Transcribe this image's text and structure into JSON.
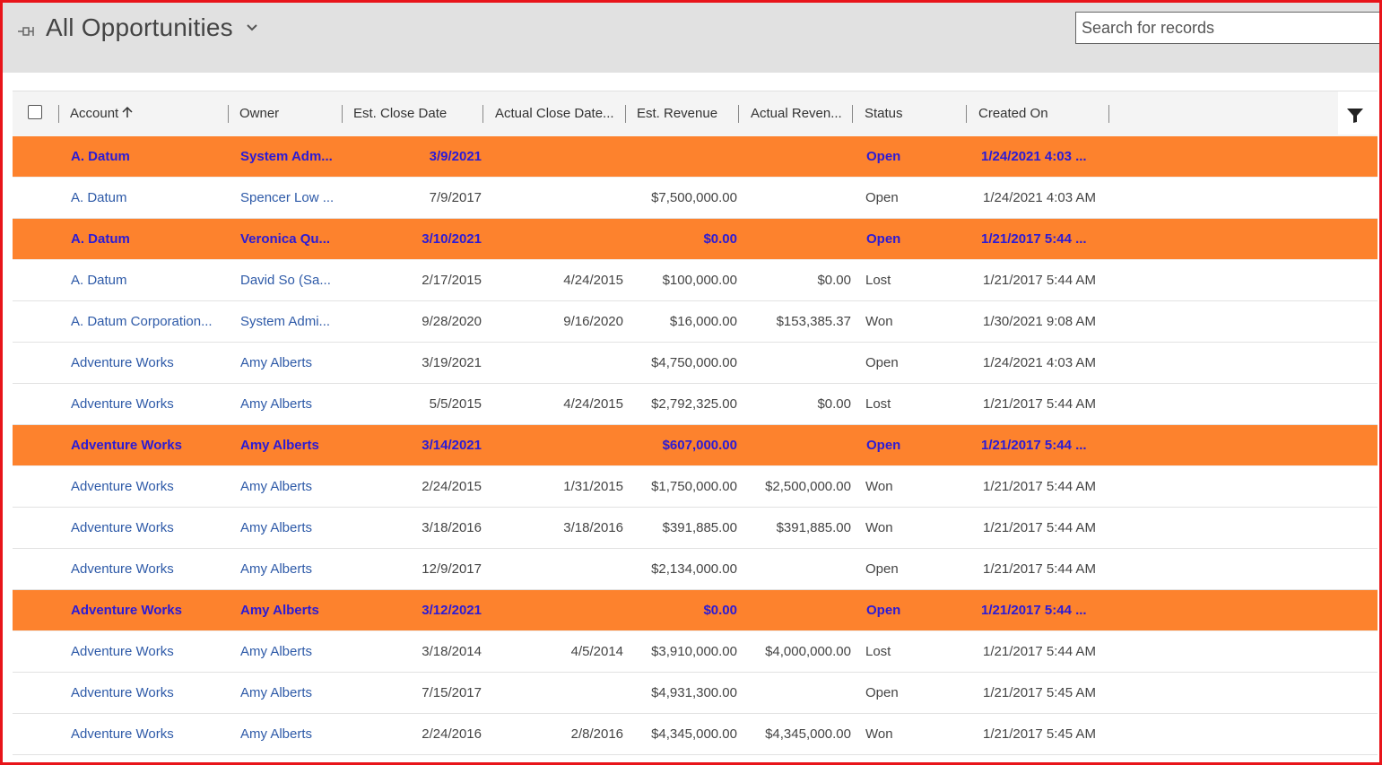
{
  "view": {
    "title": "All Opportunities"
  },
  "search": {
    "placeholder": "Search for records"
  },
  "columns": {
    "account": "Account",
    "owner": "Owner",
    "est_close_date": "Est. Close Date",
    "actual_close_date": "Actual Close Date...",
    "est_revenue": "Est. Revenue",
    "actual_revenue": "Actual Reven...",
    "status": "Status",
    "created_on": "Created On"
  },
  "colors": {
    "highlight": "#fd822d",
    "highlight_text": "#2b1bd6",
    "link": "#2e5aa8",
    "frame": "#e8141a"
  },
  "rows": [
    {
      "highlight": true,
      "account": "A. Datum",
      "owner": "System Adm...",
      "est_close": "3/9/2021",
      "act_close": "",
      "est_rev": "",
      "act_rev": "",
      "status": "Open",
      "created": "1/24/2021 4:03 ..."
    },
    {
      "highlight": false,
      "account": "A. Datum",
      "owner": "Spencer Low ...",
      "est_close": "7/9/2017",
      "act_close": "",
      "est_rev": "$7,500,000.00",
      "act_rev": "",
      "status": "Open",
      "created": "1/24/2021 4:03 AM"
    },
    {
      "highlight": true,
      "account": "A. Datum",
      "owner": "Veronica Qu...",
      "est_close": "3/10/2021",
      "act_close": "",
      "est_rev": "$0.00",
      "act_rev": "",
      "status": "Open",
      "created": "1/21/2017 5:44 ..."
    },
    {
      "highlight": false,
      "account": "A. Datum",
      "owner": "David So (Sa...",
      "est_close": "2/17/2015",
      "act_close": "4/24/2015",
      "est_rev": "$100,000.00",
      "act_rev": "$0.00",
      "status": "Lost",
      "created": "1/21/2017 5:44 AM"
    },
    {
      "highlight": false,
      "account": "A. Datum Corporation...",
      "owner": "System Admi...",
      "est_close": "9/28/2020",
      "act_close": "9/16/2020",
      "est_rev": "$16,000.00",
      "act_rev": "$153,385.37",
      "status": "Won",
      "created": "1/30/2021 9:08 AM"
    },
    {
      "highlight": false,
      "account": "Adventure Works",
      "owner": "Amy Alberts",
      "est_close": "3/19/2021",
      "act_close": "",
      "est_rev": "$4,750,000.00",
      "act_rev": "",
      "status": "Open",
      "created": "1/24/2021 4:03 AM"
    },
    {
      "highlight": false,
      "account": "Adventure Works",
      "owner": "Amy Alberts",
      "est_close": "5/5/2015",
      "act_close": "4/24/2015",
      "est_rev": "$2,792,325.00",
      "act_rev": "$0.00",
      "status": "Lost",
      "created": "1/21/2017 5:44 AM"
    },
    {
      "highlight": true,
      "account": "Adventure Works",
      "owner": "Amy Alberts",
      "est_close": "3/14/2021",
      "act_close": "",
      "est_rev": "$607,000.00",
      "act_rev": "",
      "status": "Open",
      "created": "1/21/2017 5:44 ..."
    },
    {
      "highlight": false,
      "account": "Adventure Works",
      "owner": "Amy Alberts",
      "est_close": "2/24/2015",
      "act_close": "1/31/2015",
      "est_rev": "$1,750,000.00",
      "act_rev": "$2,500,000.00",
      "status": "Won",
      "created": "1/21/2017 5:44 AM"
    },
    {
      "highlight": false,
      "account": "Adventure Works",
      "owner": "Amy Alberts",
      "est_close": "3/18/2016",
      "act_close": "3/18/2016",
      "est_rev": "$391,885.00",
      "act_rev": "$391,885.00",
      "status": "Won",
      "created": "1/21/2017 5:44 AM"
    },
    {
      "highlight": false,
      "account": "Adventure Works",
      "owner": "Amy Alberts",
      "est_close": "12/9/2017",
      "act_close": "",
      "est_rev": "$2,134,000.00",
      "act_rev": "",
      "status": "Open",
      "created": "1/21/2017 5:44 AM"
    },
    {
      "highlight": true,
      "account": "Adventure Works",
      "owner": "Amy Alberts",
      "est_close": "3/12/2021",
      "act_close": "",
      "est_rev": "$0.00",
      "act_rev": "",
      "status": "Open",
      "created": "1/21/2017 5:44 ..."
    },
    {
      "highlight": false,
      "account": "Adventure Works",
      "owner": "Amy Alberts",
      "est_close": "3/18/2014",
      "act_close": "4/5/2014",
      "est_rev": "$3,910,000.00",
      "act_rev": "$4,000,000.00",
      "status": "Lost",
      "created": "1/21/2017 5:44 AM"
    },
    {
      "highlight": false,
      "account": "Adventure Works",
      "owner": "Amy Alberts",
      "est_close": "7/15/2017",
      "act_close": "",
      "est_rev": "$4,931,300.00",
      "act_rev": "",
      "status": "Open",
      "created": "1/21/2017 5:45 AM"
    },
    {
      "highlight": false,
      "account": "Adventure Works",
      "owner": "Amy Alberts",
      "est_close": "2/24/2016",
      "act_close": "2/8/2016",
      "est_rev": "$4,345,000.00",
      "act_rev": "$4,345,000.00",
      "status": "Won",
      "created": "1/21/2017 5:45 AM"
    }
  ]
}
